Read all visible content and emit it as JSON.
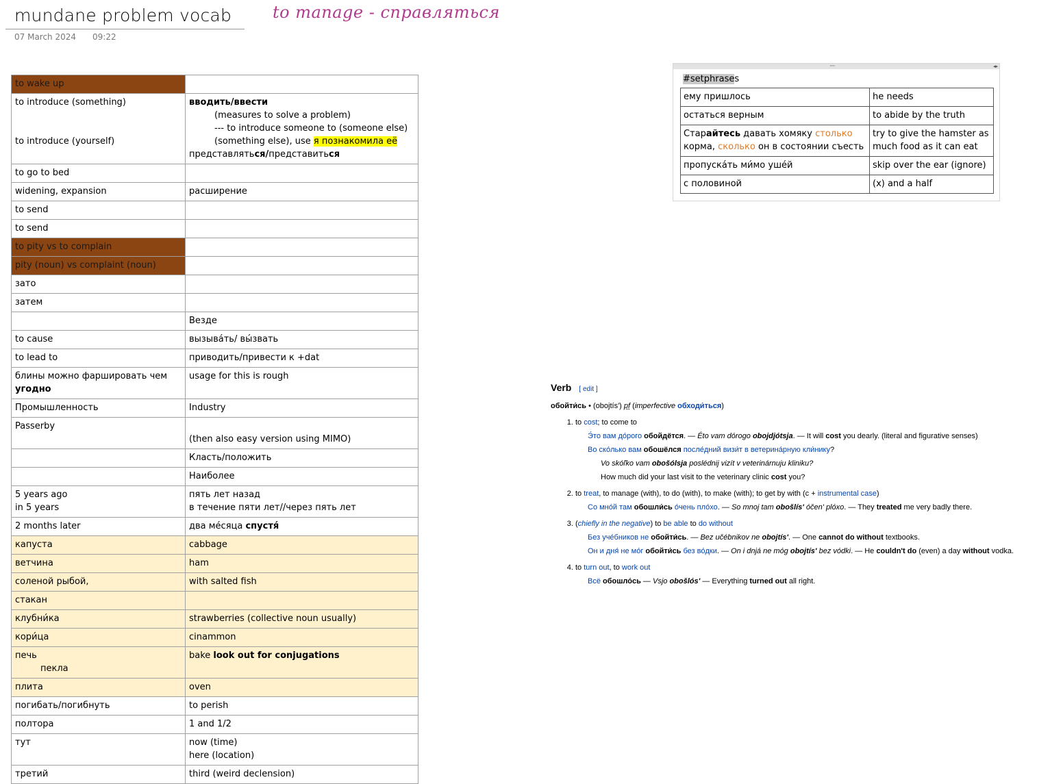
{
  "header": {
    "title": "mundane problem vocab",
    "date": "07 March 2024",
    "time": "09:22",
    "handwriting": "to manage - справляться"
  },
  "setphrases": {
    "tag_shaded": "#setphrase",
    "tag_rest": "s",
    "rows": [
      {
        "ru": "ему пришлось",
        "en": "he needs"
      },
      {
        "ru": "остаться верным",
        "en": "to abide by the truth"
      },
      {
        "ru_a": "Стар",
        "ru_b": "айтесь",
        "ru_c": " давать хомяку ",
        "ru_d": "столько",
        "ru_e": " корма, ",
        "ru_f": "сколько",
        "ru_g": " он в состоянии съесть",
        "en": "try to give the hamster as much food as it can eat"
      },
      {
        "ru": "пропуска́ть ми́мо уше́й",
        "en": "skip over the ear (ignore)"
      },
      {
        "ru": "с половиной",
        "en": "(x) and a half"
      }
    ]
  },
  "vocab": {
    "r1": {
      "a": "to wake up",
      "b": ""
    },
    "r2": {
      "a1": "to introduce (something)",
      "a2": "to introduce (yourself)",
      "b1": "вводить/ввести",
      "b2": "(measures to solve a problem)",
      "b3": "--- to introduce someone to (someone else)",
      "b4": "(something else), use ",
      "b4_hl": "я познакомила её",
      "b5a": "представлять",
      "b5b": "ся/",
      "b5c": "представить",
      "b5d": "ся"
    },
    "r3": {
      "a": "to go to bed",
      "b": ""
    },
    "r4": {
      "a": "widening, expansion",
      "b": "расширение"
    },
    "r5": {
      "a": "to send",
      "b": ""
    },
    "r6": {
      "a": "to send",
      "b": ""
    },
    "r7": {
      "a": "to pity vs to complain",
      "b": ""
    },
    "r8": {
      "a": "pity (noun) vs complaint (noun)",
      "b": ""
    },
    "r9": {
      "a": "зато",
      "b": ""
    },
    "r10": {
      "a": "затем",
      "b": ""
    },
    "r11": {
      "a": "",
      "b": "Везде"
    },
    "r12": {
      "a": "to cause",
      "b": "вызыва́ть/ вы́звать"
    },
    "r13": {
      "a": "to lead to",
      "b": "приводить/привести к +dat"
    },
    "r14": {
      "a1": "блины можно фаршировать чем",
      "a2": "угодно",
      "b": "usage for this is rough"
    },
    "r15": {
      "a": "Промышленность",
      "b": "Industry"
    },
    "r16": {
      "a": "Passerby",
      "b": "(then also easy version using MIMO)"
    },
    "r17": {
      "a": "",
      "b": "Класть/положить"
    },
    "r18": {
      "a": "",
      "b": "Наиболее"
    },
    "r19": {
      "a1": "5 years ago",
      "a2": "in 5 years",
      "b1": "пять лет назад",
      "b2": "в течение пяти лет//через пять лет"
    },
    "r20": {
      "a": "2 months later",
      "b1": "два ме́сяца ",
      "b2": "спустя́"
    },
    "r21": {
      "a": "капуста",
      "b": "cabbage"
    },
    "r22": {
      "a": "ветчина",
      "b": "ham"
    },
    "r23": {
      "a": "соленой рыбой,",
      "b": "with salted fish"
    },
    "r24": {
      "a": "стакан",
      "b": ""
    },
    "r25": {
      "a": "клубни́ка",
      "b": "strawberries (collective noun usually)"
    },
    "r26": {
      "a": "кори́ца",
      "b": "cinammon"
    },
    "r27": {
      "a1": "печь",
      "a2": "пекла",
      "b1": "bake ",
      "b2": "look out for conjugations"
    },
    "r28": {
      "a": "плита",
      "b": "oven"
    },
    "r29": {
      "a": "погибать/погибнуть",
      "b": "to perish"
    },
    "r30": {
      "a": "полтора",
      "b": "1 and 1/2"
    },
    "r31": {
      "a": "тут",
      "b1": "now (time)",
      "b2": "here (location)"
    },
    "r32": {
      "a": "третий",
      "b": "third (weird declension)"
    }
  },
  "dict": {
    "heading": "Verb",
    "edit": "[ edit ]",
    "hw": "обойти́сь",
    "bullet": " • (obojtís') ",
    "pf": "pf",
    "paren_open": " (",
    "impf": "imperfective",
    "impf_link": "обходи́ться",
    "paren_close": ")",
    "s1": {
      "pre": "to ",
      "l1": "cost",
      "post": "; to come to",
      "e1_ru": "Э́то вам до́рого ",
      "e1_ru_b": "обойдётся",
      "e1_sep": ". — ",
      "e1_tr": "Éto vam dórogo ",
      "e1_tr_b": "obojdjótsja",
      "e1_sep2": ". — It will ",
      "e1_en_b": "cost",
      "e1_en": " you dearly. (literal and figurative senses)",
      "e2_a": "Во ско́лько вам ",
      "e2_b": "обошёлся",
      "e2_c": " после́дний визи́т в ветерина́рную кли́нику",
      "e2_d": "?",
      "e2_tr_a": "Vo skóľko vam ",
      "e2_tr_b": "obošólsja",
      "e2_tr_c": " poslédnij vizít v veterinárnuju kliniku?",
      "e2_en_a": "How much did your last visit to the veterinary clinic ",
      "e2_en_b": "cost",
      "e2_en_c": " you?"
    },
    "s2": {
      "pre": "to ",
      "l1": "treat",
      "post": ", to manage (with), to do (with), to make (with); to get by with (с + ",
      "l2": "instrumental case",
      "post2": ")",
      "e_a": "Со мно́й там ",
      "e_b": "обошли́сь",
      "e_c": " о́чень пло́хо",
      "e_d": ". — ",
      "e_tr": "So mnoj tam ",
      "e_tr_b": "obošlís'",
      "e_tr_c": " óčen' plóxo",
      "e_sep": ". — They ",
      "e_en_b": "treated",
      "e_en": " me very badly there."
    },
    "s3": {
      "p1": "(",
      "l1": "chiefly in the negative",
      "p2": ") to ",
      "l2": "be able",
      "p3": " to ",
      "l3": "do without",
      "e1_a": "Без уче́бников не ",
      "e1_b": "обойти́сь",
      "e1_c": ". — ",
      "e1_tr": "Bez učébnikov ne ",
      "e1_tr_b": "obojtís'",
      "e1_sep": ". — One ",
      "e1_en_b": "cannot do without",
      "e1_en": " textbooks.",
      "e2_a": "Он и дня́ не мо́г ",
      "e2_b": "обойти́сь",
      "e2_c": " без во́дки",
      "e2_d": ". — ",
      "e2_tr": "On i dnjá ne móg ",
      "e2_tr_b": "obojtís'",
      "e2_tr_c": " bez vódki",
      "e2_sep": ". — He ",
      "e2_en_b": "couldn't do",
      "e2_en": " (even) a day ",
      "e2_en_b2": "without",
      "e2_en2": " vodka."
    },
    "s4": {
      "pre": "to ",
      "l1": "turn out",
      "mid": ", to ",
      "l2": "work out",
      "e_a": "Всё ",
      "e_b": "обошло́сь",
      "e_c": " — ",
      "e_tr": "Vsjo ",
      "e_tr_b": "obošlós'",
      "e_sep": " — Everything ",
      "e_en_b": "turned out",
      "e_en": " all right."
    }
  }
}
